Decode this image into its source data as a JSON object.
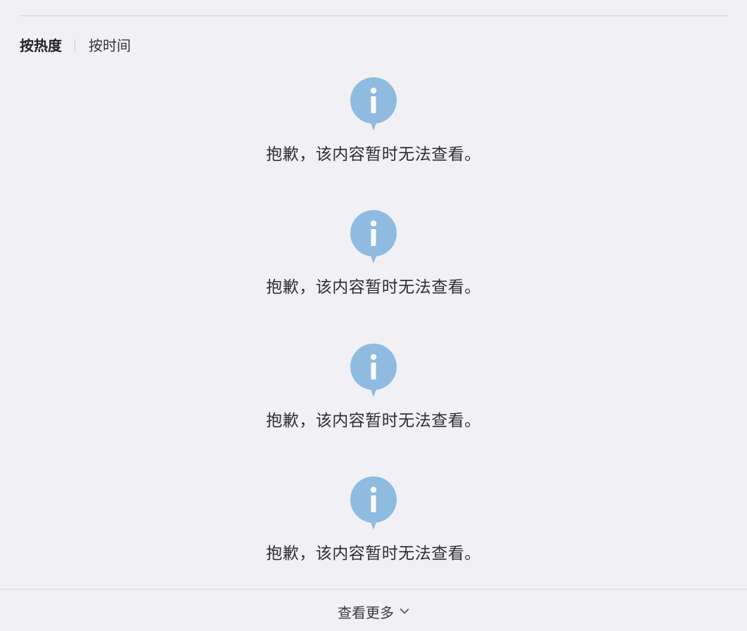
{
  "sort_tabs": {
    "by_popularity": "按热度",
    "by_time": "按时间",
    "active": "by_popularity"
  },
  "notices": [
    {
      "icon": "info-bubble-icon",
      "text": "抱歉，该内容暂时无法查看。"
    },
    {
      "icon": "info-bubble-icon",
      "text": "抱歉，该内容暂时无法查看。"
    },
    {
      "icon": "info-bubble-icon",
      "text": "抱歉，该内容暂时无法查看。"
    },
    {
      "icon": "info-bubble-icon",
      "text": "抱歉，该内容暂时无法查看。"
    }
  ],
  "load_more": {
    "label": "查看更多",
    "icon": "chevron-down-icon"
  },
  "colors": {
    "background": "#f1f1f5",
    "info_icon": "#8fbbe0",
    "divider": "#d6d6da"
  }
}
